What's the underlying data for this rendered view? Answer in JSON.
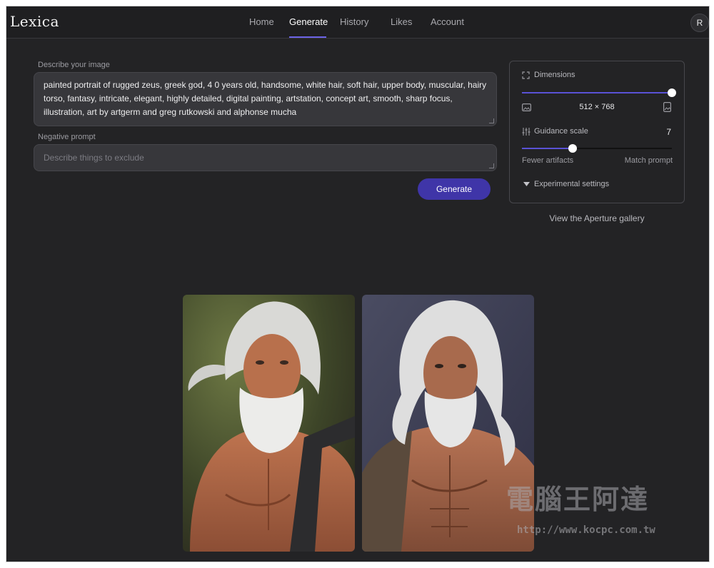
{
  "app": {
    "logo": "Lexica"
  },
  "nav": {
    "items": [
      "Home",
      "Generate",
      "History",
      "Likes",
      "Account"
    ],
    "active": "Generate",
    "avatar": "R"
  },
  "form": {
    "prompt_label": "Describe your image",
    "prompt_value": "painted portrait of rugged zeus, greek god, 4 0 years old, handsome, white hair, soft hair, upper body, muscular, hairy torso, fantasy, intricate, elegant, highly detailed, digital painting, artstation, concept art, smooth, sharp focus, illustration, art by artgerm and greg rutkowski and alphonse mucha",
    "negative_label": "Negative prompt",
    "negative_placeholder": "Describe things to exclude",
    "generate_label": "Generate"
  },
  "settings": {
    "dimensions_label": "Dimensions",
    "dimensions_value": "512 × 768",
    "dimensions_slider_fraction": 1.0,
    "guidance_label": "Guidance scale",
    "guidance_value": "7",
    "guidance_slider_fraction": 0.34,
    "guidance_min_label": "Fewer artifacts",
    "guidance_max_label": "Match prompt",
    "experimental_label": "Experimental settings"
  },
  "gallery_link": "View the Aperture gallery",
  "watermark": {
    "text": "電腦王阿達",
    "url": "http://www.kocpc.com.tw"
  },
  "colors": {
    "accent": "#5a52d6",
    "button": "#3f35a8",
    "background": "#232325"
  }
}
